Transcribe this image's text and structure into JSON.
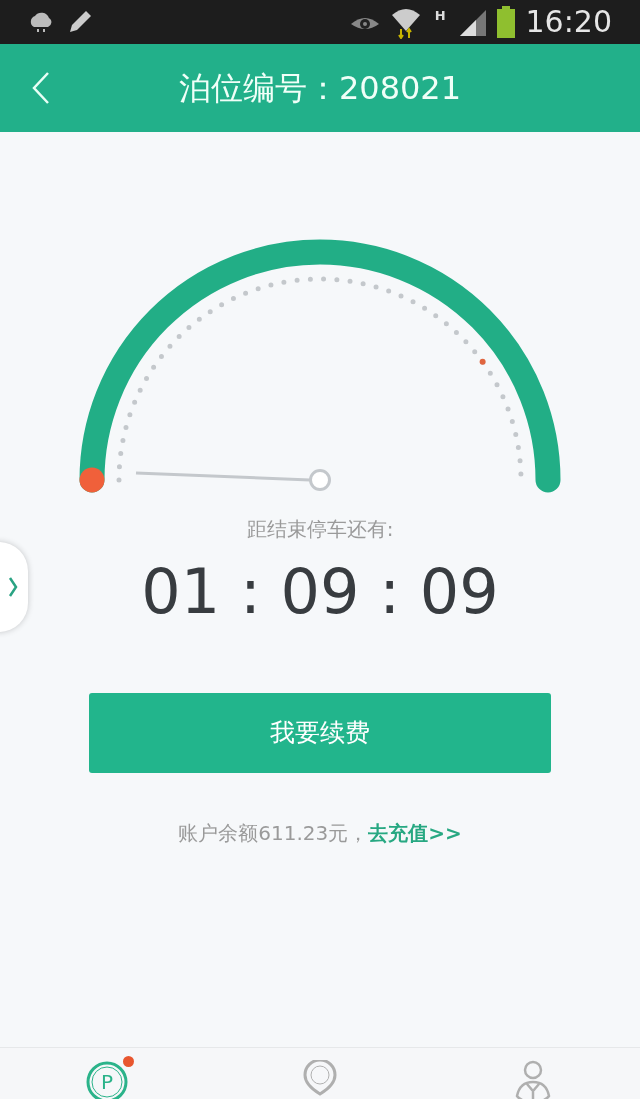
{
  "status_bar": {
    "time": "16:20",
    "network": "H"
  },
  "header": {
    "title": "泊位编号：208021"
  },
  "countdown": {
    "label": "距结束停车还有:",
    "time": "01 : 09 : 09"
  },
  "renew_button": "我要续费",
  "balance": {
    "text": "账户余额611.23元，",
    "link": "去充值>>"
  },
  "tabs": [
    {
      "kind": "parking",
      "letter": "P",
      "selected": true,
      "badge": true
    },
    {
      "kind": "location",
      "selected": false,
      "badge": false
    },
    {
      "kind": "profile",
      "selected": false,
      "badge": false
    }
  ]
}
